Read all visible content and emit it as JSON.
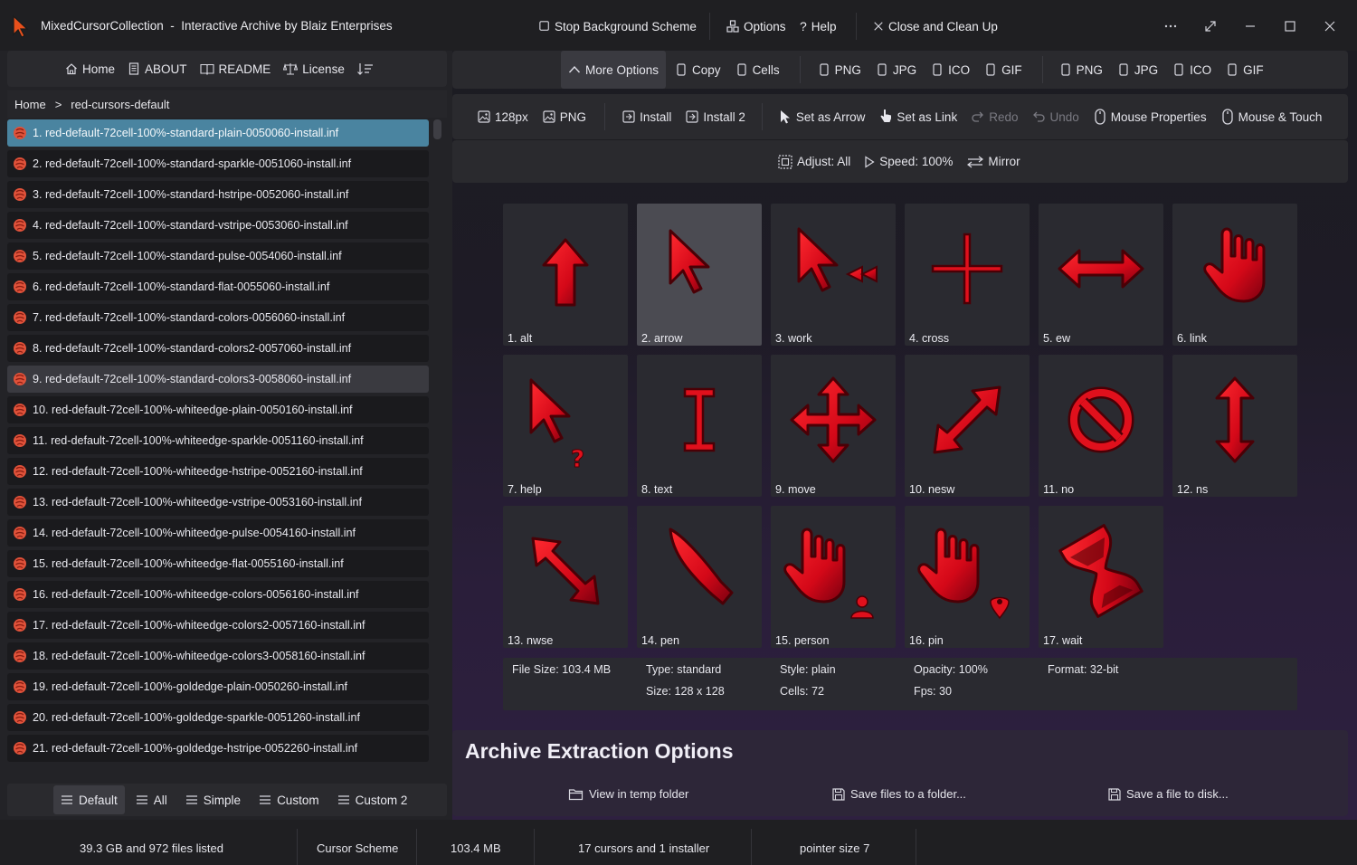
{
  "titlebar": {
    "app_name": "MixedCursorCollection  -  Interactive Archive by Blaiz Enterprises",
    "stop_bg": "Stop Background Scheme",
    "options": "Options",
    "help": "Help",
    "close_clean": "Close and Clean Up",
    "more_icon": "ellipsis-icon",
    "expand_icon": "expand-icon",
    "minimize_icon": "minimize-icon",
    "maximize_icon": "maximize-icon",
    "close_icon": "close-icon"
  },
  "nav": {
    "home": "Home",
    "about": "ABOUT",
    "readme": "README",
    "license": "License",
    "sort_icon": "sort-icon"
  },
  "breadcrumb": {
    "root": "Home",
    "separator": ">",
    "current": "red-cursors-default"
  },
  "files": [
    "1. red-default-72cell-100%-standard-plain-0050060-install.inf",
    "2. red-default-72cell-100%-standard-sparkle-0051060-install.inf",
    "3. red-default-72cell-100%-standard-hstripe-0052060-install.inf",
    "4. red-default-72cell-100%-standard-vstripe-0053060-install.inf",
    "5. red-default-72cell-100%-standard-pulse-0054060-install.inf",
    "6. red-default-72cell-100%-standard-flat-0055060-install.inf",
    "7. red-default-72cell-100%-standard-colors-0056060-install.inf",
    "8. red-default-72cell-100%-standard-colors2-0057060-install.inf",
    "9. red-default-72cell-100%-standard-colors3-0058060-install.inf",
    "10. red-default-72cell-100%-whiteedge-plain-0050160-install.inf",
    "11. red-default-72cell-100%-whiteedge-sparkle-0051160-install.inf",
    "12. red-default-72cell-100%-whiteedge-hstripe-0052160-install.inf",
    "13. red-default-72cell-100%-whiteedge-vstripe-0053160-install.inf",
    "14. red-default-72cell-100%-whiteedge-pulse-0054160-install.inf",
    "15. red-default-72cell-100%-whiteedge-flat-0055160-install.inf",
    "16. red-default-72cell-100%-whiteedge-colors-0056160-install.inf",
    "17. red-default-72cell-100%-whiteedge-colors2-0057160-install.inf",
    "18. red-default-72cell-100%-whiteedge-colors3-0058160-install.inf",
    "19. red-default-72cell-100%-goldedge-plain-0050260-install.inf",
    "20. red-default-72cell-100%-goldedge-sparkle-0051260-install.inf",
    "21. red-default-72cell-100%-goldedge-hstripe-0052260-install.inf"
  ],
  "file_selected_index": 0,
  "file_hover_index": 8,
  "list_tabs": {
    "default": "Default",
    "all": "All",
    "simple": "Simple",
    "custom": "Custom",
    "custom2": "Custom 2"
  },
  "toolbar1": {
    "more_options": "More Options",
    "copy": "Copy",
    "cells": "Cells",
    "png1": "PNG",
    "jpg1": "JPG",
    "ico1": "ICO",
    "gif1": "GIF",
    "png2": "PNG",
    "jpg2": "JPG",
    "ico2": "ICO",
    "gif2": "GIF"
  },
  "toolbar2": {
    "size": "128px",
    "png": "PNG",
    "install": "Install",
    "install2": "Install 2",
    "set_arrow": "Set as Arrow",
    "set_link": "Set as Link",
    "redo": "Redo",
    "undo": "Undo",
    "mouse_props": "Mouse Properties",
    "mouse_touch": "Mouse & Touch"
  },
  "toolbar3": {
    "adjust": "Adjust: All",
    "speed": "Speed: 100%",
    "mirror": "Mirror"
  },
  "cursors": [
    {
      "label": "1. alt",
      "icon": "up-arrow-cursor-icon"
    },
    {
      "label": "2. arrow",
      "icon": "arrow-cursor-icon"
    },
    {
      "label": "3. work",
      "icon": "work-cursor-icon"
    },
    {
      "label": "4. cross",
      "icon": "cross-cursor-icon"
    },
    {
      "label": "5. ew",
      "icon": "ew-resize-cursor-icon"
    },
    {
      "label": "6. link",
      "icon": "hand-cursor-icon"
    },
    {
      "label": "7. help",
      "icon": "help-cursor-icon"
    },
    {
      "label": "8. text",
      "icon": "text-cursor-icon"
    },
    {
      "label": "9. move",
      "icon": "move-cursor-icon"
    },
    {
      "label": "10. nesw",
      "icon": "nesw-resize-cursor-icon"
    },
    {
      "label": "11. no",
      "icon": "no-cursor-icon"
    },
    {
      "label": "12. ns",
      "icon": "ns-resize-cursor-icon"
    },
    {
      "label": "13. nwse",
      "icon": "nwse-resize-cursor-icon"
    },
    {
      "label": "14. pen",
      "icon": "pen-cursor-icon"
    },
    {
      "label": "15. person",
      "icon": "person-cursor-icon"
    },
    {
      "label": "16. pin",
      "icon": "pin-cursor-icon"
    },
    {
      "label": "17. wait",
      "icon": "wait-cursor-icon"
    }
  ],
  "cursor_selected_index": 1,
  "info": {
    "file_size": "File Size: 103.4 MB",
    "type": "Type: standard",
    "size": "Size: 128 x 128",
    "style": "Style: plain",
    "cells": "Cells: 72",
    "opacity": "Opacity: 100%",
    "fps": "Fps: 30",
    "format": "Format: 32-bit"
  },
  "extract": {
    "title": "Archive Extraction Options",
    "view_temp": "View in temp folder",
    "save_folder": "Save files to a folder...",
    "save_disk": "Save a file to disk..."
  },
  "status": {
    "listed": "39.3 GB and 972 files listed",
    "kind": "Cursor Scheme",
    "size": "103.4 MB",
    "count": "17 cursors and 1 installer",
    "pointer": "pointer size 7"
  },
  "colors": {
    "cursor_red": "#e0101c",
    "cursor_dark": "#5a0008",
    "selection_blue": "#4a84a0"
  }
}
